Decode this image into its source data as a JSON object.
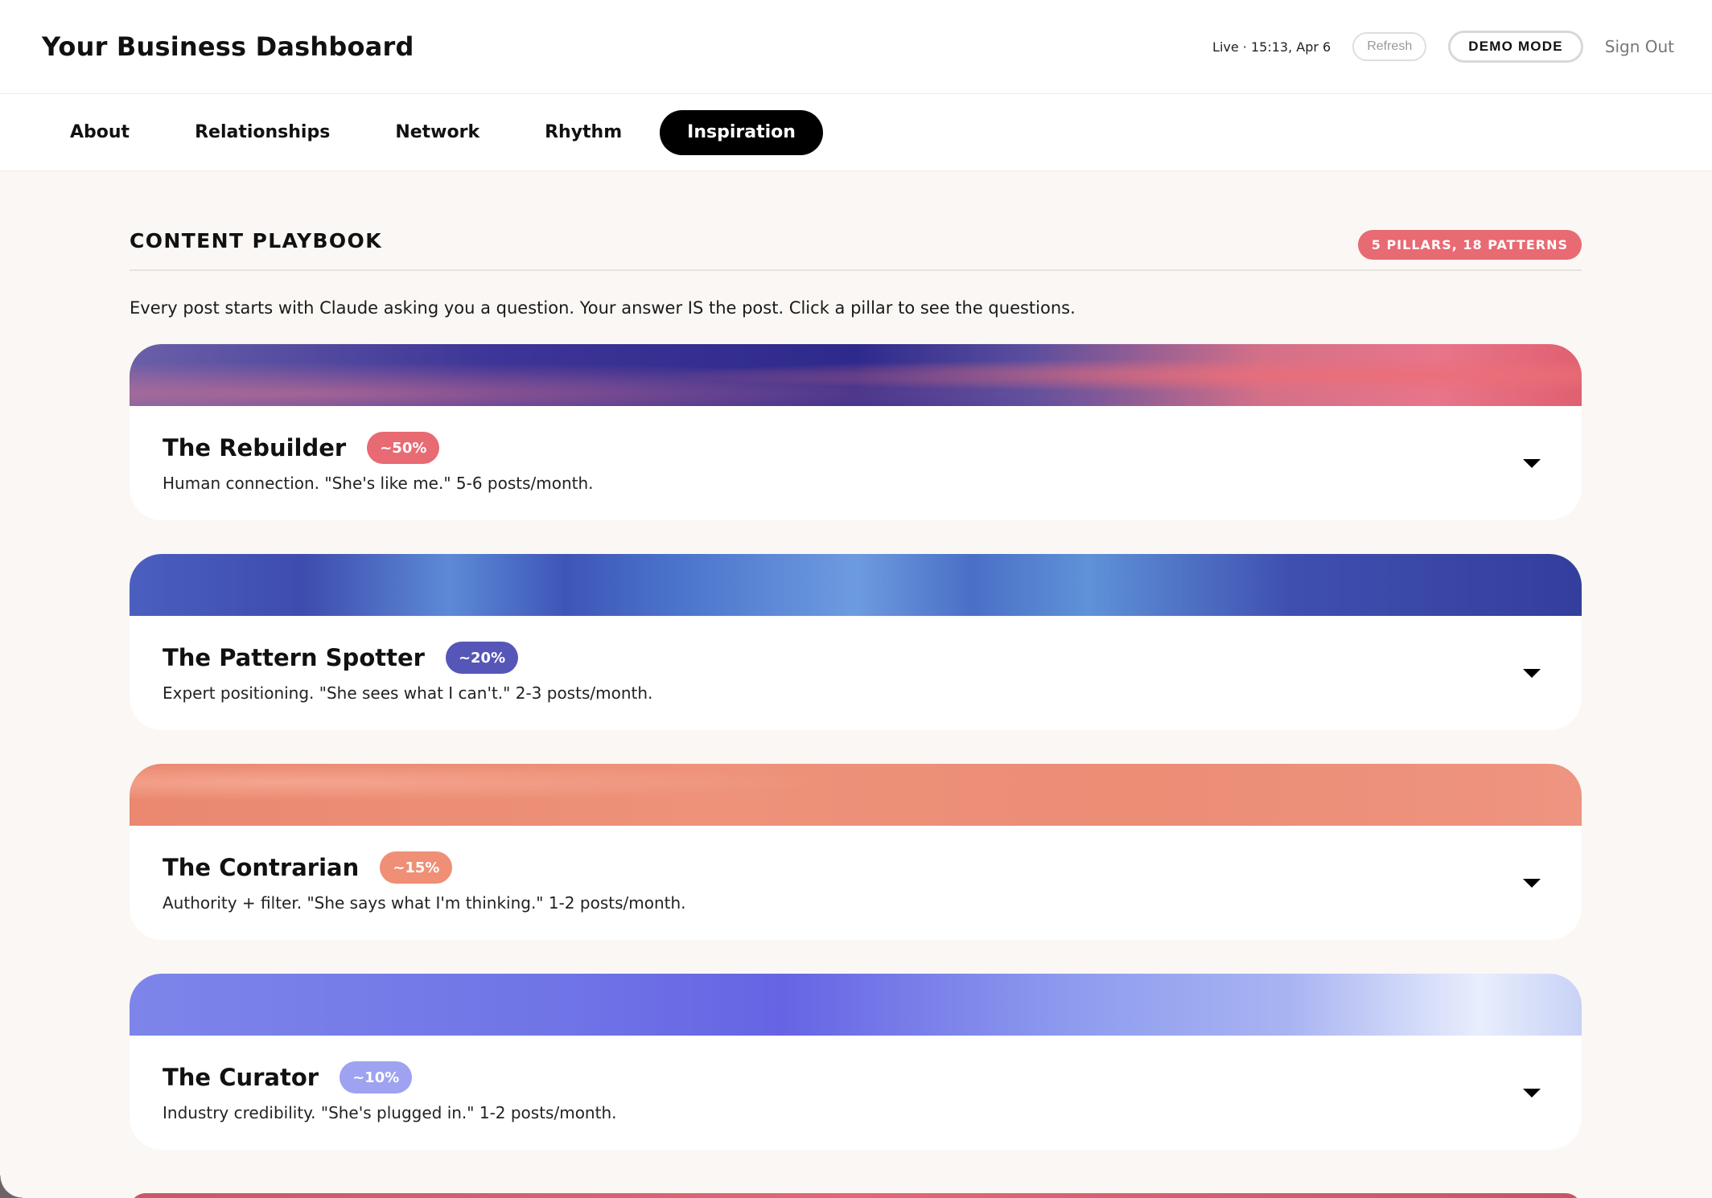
{
  "header": {
    "title": "Your Business Dashboard",
    "live_status": "Live · 15:13, Apr 6",
    "refresh_label": "Refresh",
    "demo_label": "DEMO MODE",
    "signout_label": "Sign Out"
  },
  "tabs": [
    {
      "label": "About",
      "active": false
    },
    {
      "label": "Relationships",
      "active": false
    },
    {
      "label": "Network",
      "active": false
    },
    {
      "label": "Rhythm",
      "active": false
    },
    {
      "label": "Inspiration",
      "active": true
    }
  ],
  "playbook": {
    "title": "CONTENT PLAYBOOK",
    "count_badge": "5 PILLARS, 18 PATTERNS",
    "intro": "Every post starts with Claude asking you a question. Your answer IS the post. Click a pillar to see the questions.",
    "pillars": [
      {
        "name": "The Rebuilder",
        "share": "~50%",
        "share_color": "#e86a72",
        "description": "Human connection. \"She's like me.\" 5-6 posts/month.",
        "expanded": false
      },
      {
        "name": "The Pattern Spotter",
        "share": "~20%",
        "share_color": "#5656b8",
        "description": "Expert positioning. \"She sees what I can't.\" 2-3 posts/month.",
        "expanded": false
      },
      {
        "name": "The Contrarian",
        "share": "~15%",
        "share_color": "#ee8f76",
        "description": "Authority + filter. \"She says what I'm thinking.\" 1-2 posts/month.",
        "expanded": false
      },
      {
        "name": "The Curator",
        "share": "~10%",
        "share_color": "#9ea2f0",
        "description": "Industry credibility. \"She's plugged in.\" 1-2 posts/month.",
        "expanded": false
      }
    ]
  },
  "colors": {
    "accent": "#e86a72",
    "background": "#faf7f4",
    "active_tab": "#000000"
  }
}
